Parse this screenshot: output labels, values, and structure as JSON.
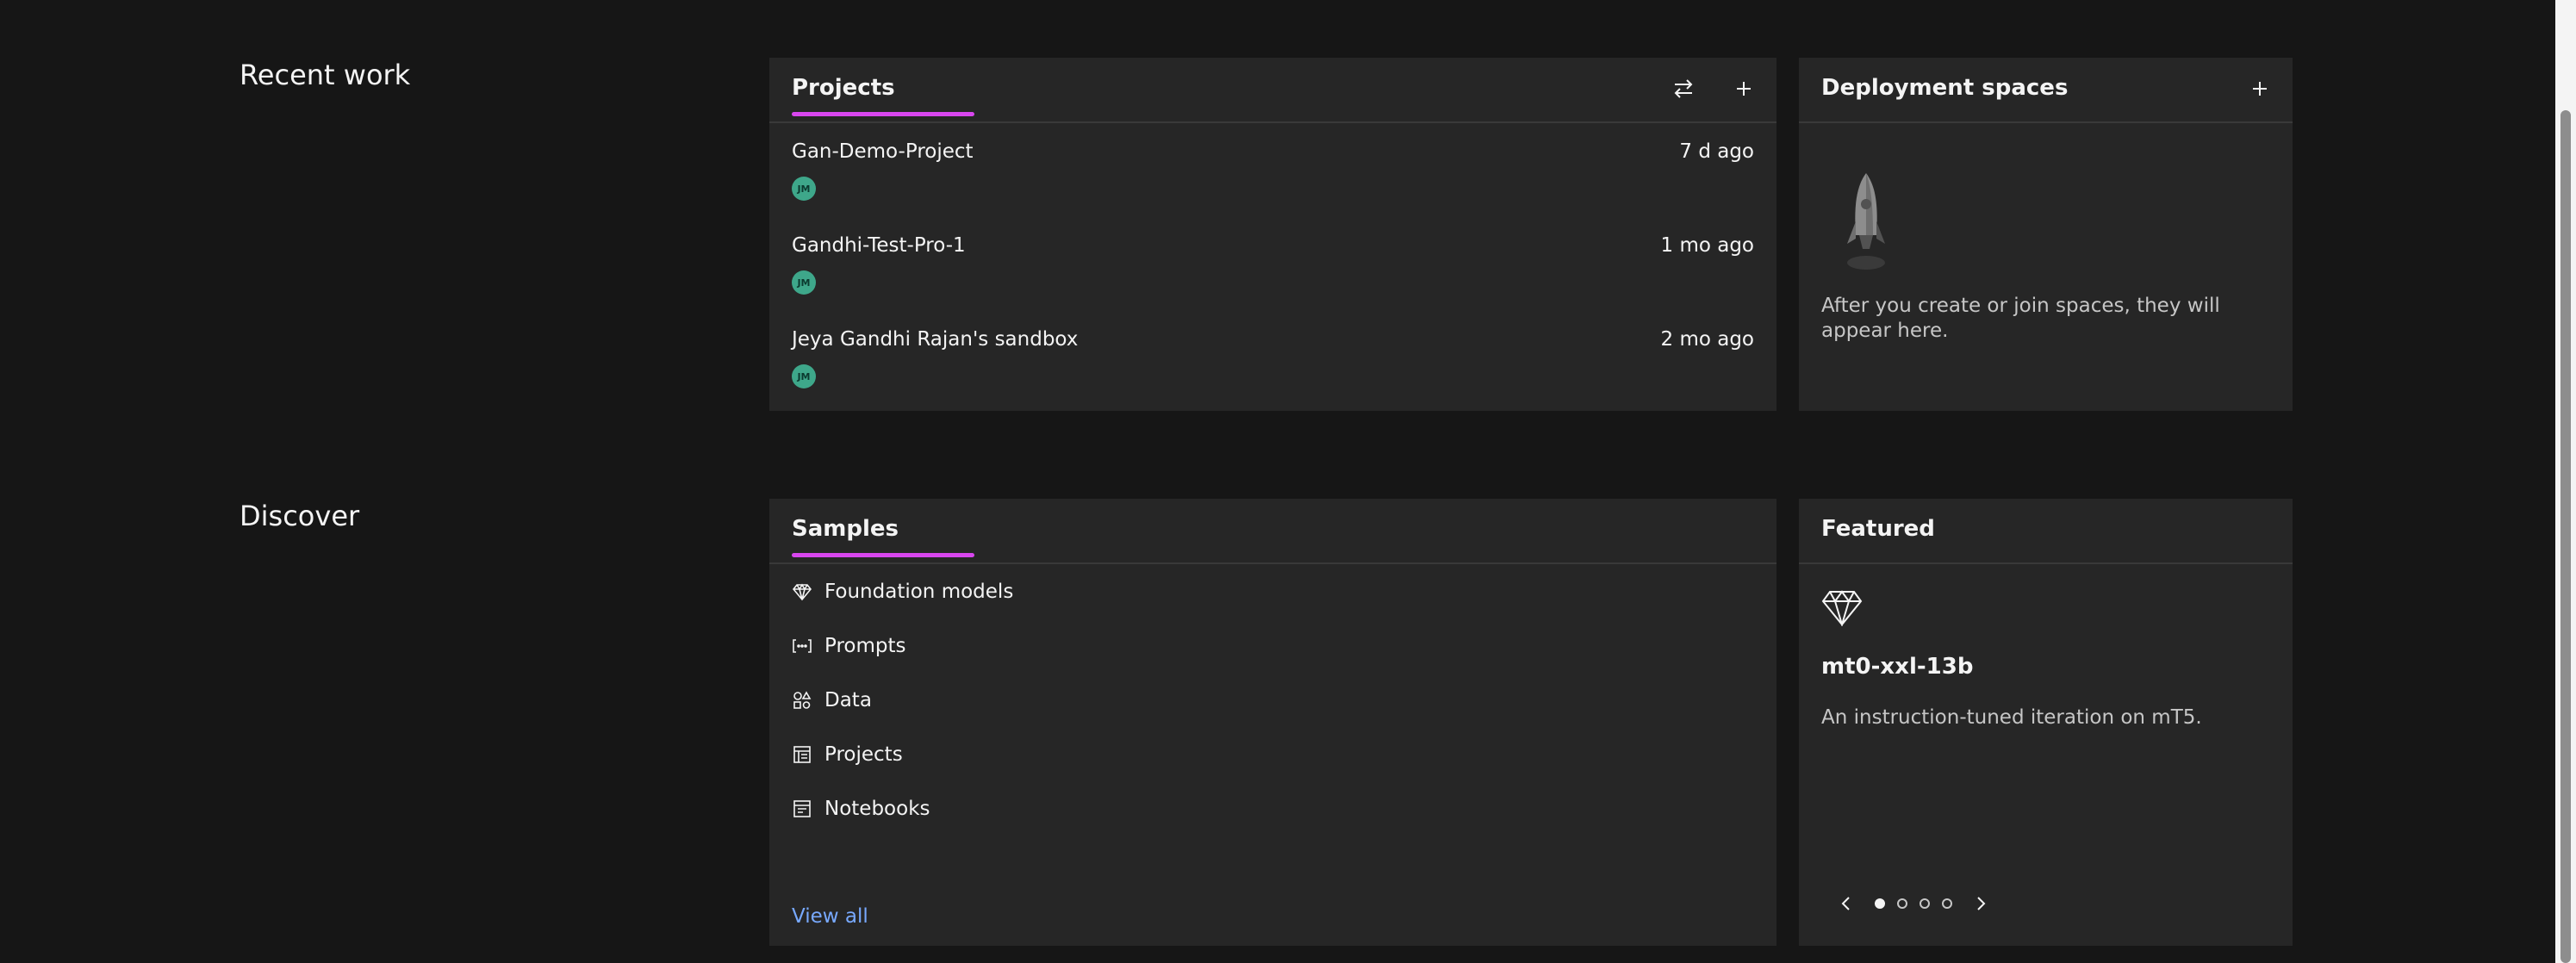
{
  "recent_work": {
    "section_title": "Recent work",
    "projects_tile": {
      "title": "Projects",
      "items": [
        {
          "name": "Gan-Demo-Project",
          "time": "7 d ago",
          "avatar": "JM"
        },
        {
          "name": "Gandhi-Test-Pro-1",
          "time": "1 mo ago",
          "avatar": "JM"
        },
        {
          "name": "Jeya Gandhi Rajan's sandbox",
          "time": "2 mo ago",
          "avatar": "JM"
        }
      ]
    },
    "deployment_tile": {
      "title": "Deployment spaces",
      "empty_message": "After you create or join spaces, they will appear here."
    }
  },
  "discover": {
    "section_title": "Discover",
    "samples_tile": {
      "title": "Samples",
      "items": [
        {
          "label": "Foundation models",
          "icon": "diamond-icon"
        },
        {
          "label": "Prompts",
          "icon": "prompt-brackets-icon"
        },
        {
          "label": "Data",
          "icon": "data-shapes-icon"
        },
        {
          "label": "Projects",
          "icon": "project-icon"
        },
        {
          "label": "Notebooks",
          "icon": "notebook-icon"
        }
      ],
      "view_all": "View all"
    },
    "featured_tile": {
      "title": "Featured",
      "model_name": "mt0-xxl-13b",
      "description": "An instruction-tuned iteration on mT5.",
      "carousel": {
        "total": 4,
        "active_index": 0
      }
    }
  },
  "colors": {
    "background": "#161616",
    "tile": "#262626",
    "accent_underline": "#d946ef",
    "link": "#78a9ff",
    "avatar": "#3ea78a"
  }
}
